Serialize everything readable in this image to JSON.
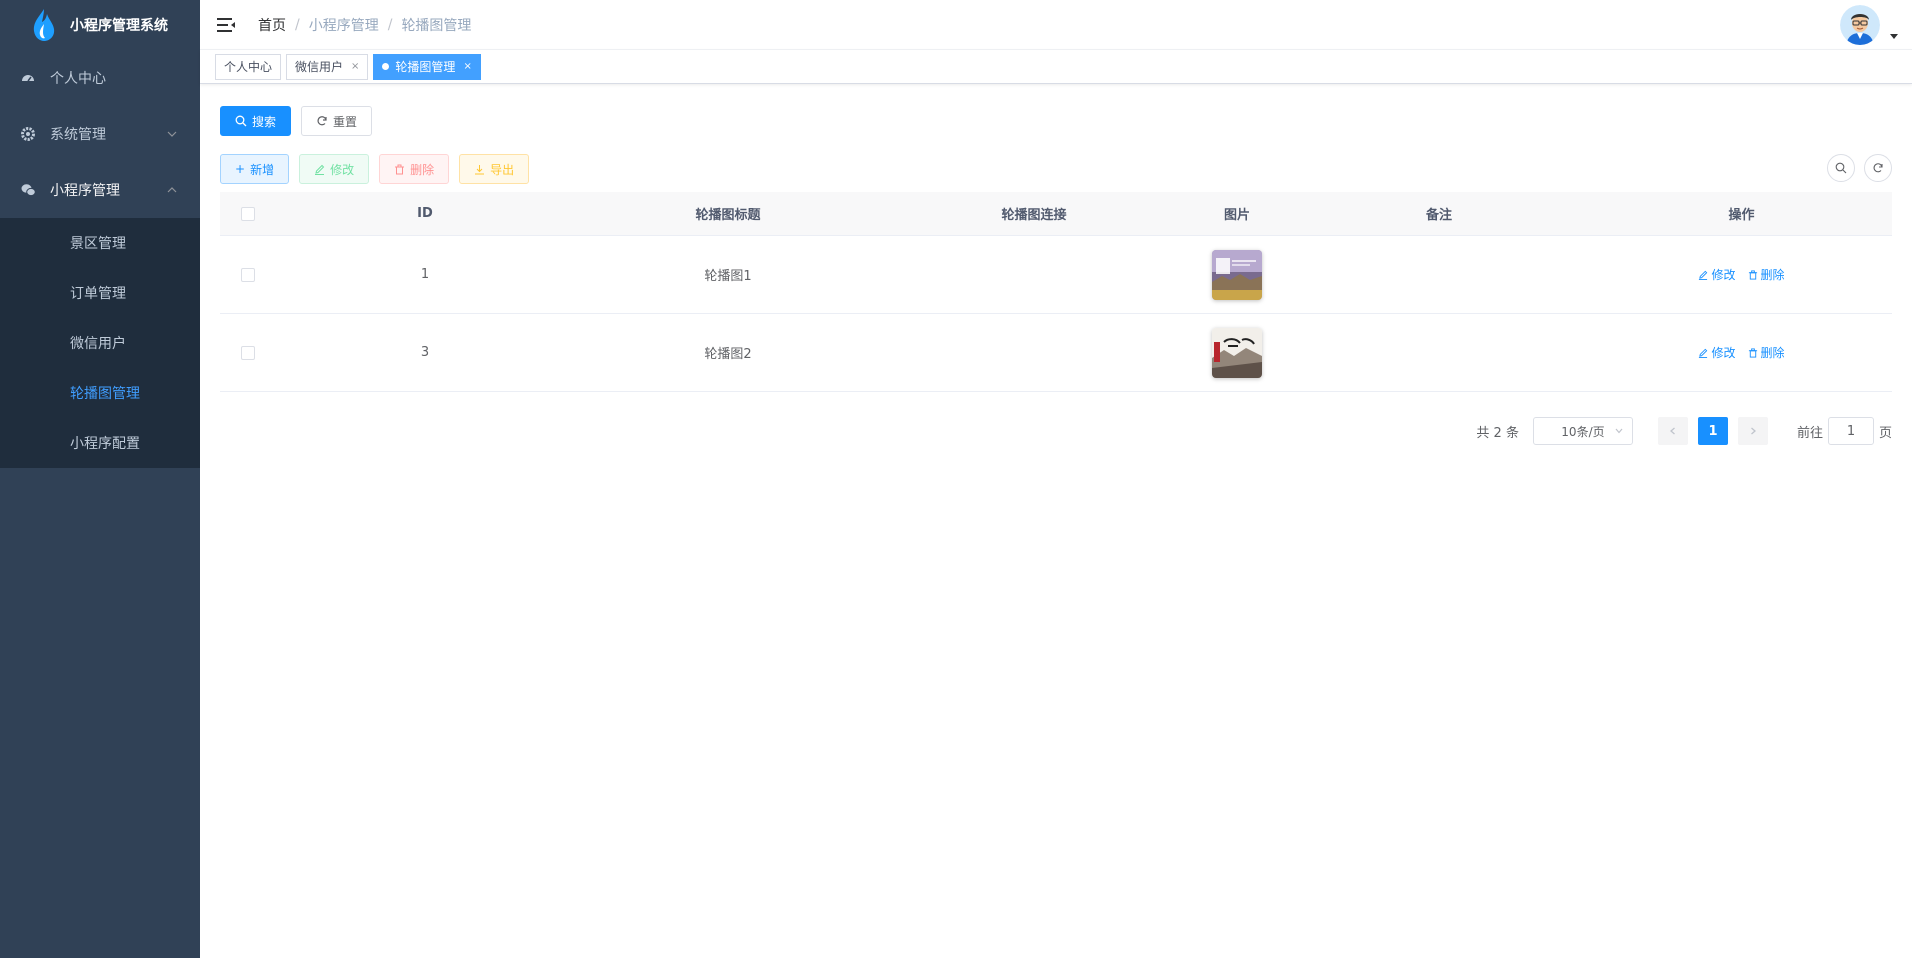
{
  "app": {
    "title": "小程序管理系统"
  },
  "sidebar": {
    "items": [
      {
        "label": "个人中心",
        "icon": "dashboard-icon"
      },
      {
        "label": "系统管理",
        "icon": "gear-icon"
      },
      {
        "label": "小程序管理",
        "icon": "wechat-icon"
      }
    ],
    "submenu": [
      {
        "label": "景区管理",
        "active": false
      },
      {
        "label": "订单管理",
        "active": false
      },
      {
        "label": "微信用户",
        "active": false
      },
      {
        "label": "轮播图管理",
        "active": true
      },
      {
        "label": "小程序配置",
        "active": false
      }
    ]
  },
  "breadcrumb": [
    "首页",
    "小程序管理",
    "轮播图管理"
  ],
  "tags": [
    {
      "label": "个人中心",
      "closable": false,
      "active": false
    },
    {
      "label": "微信用户",
      "closable": true,
      "active": false
    },
    {
      "label": "轮播图管理",
      "closable": true,
      "active": true
    }
  ],
  "toolbar": {
    "search_label": "搜索",
    "reset_label": "重置",
    "add_label": "新增",
    "edit_label": "修改",
    "delete_label": "删除",
    "export_label": "导出"
  },
  "table": {
    "headers": {
      "id": "ID",
      "title": "轮播图标题",
      "link": "轮播图连接",
      "image": "图片",
      "note": "备注",
      "op": "操作"
    },
    "rows": [
      {
        "id": "1",
        "title": "轮播图1",
        "link": "",
        "note": ""
      },
      {
        "id": "3",
        "title": "轮播图2",
        "link": "",
        "note": ""
      }
    ],
    "op_edit": "修改",
    "op_delete": "删除"
  },
  "pagination": {
    "total": "共 2 条",
    "page_size": "10条/页",
    "current": "1",
    "goto_prefix": "前往",
    "goto_value": "1",
    "goto_suffix": "页"
  },
  "colors": {
    "sidebar_bg": "#304156",
    "submenu_bg": "#1f2d3d",
    "primary": "#1890ff",
    "active_tag": "#42a0ff"
  }
}
